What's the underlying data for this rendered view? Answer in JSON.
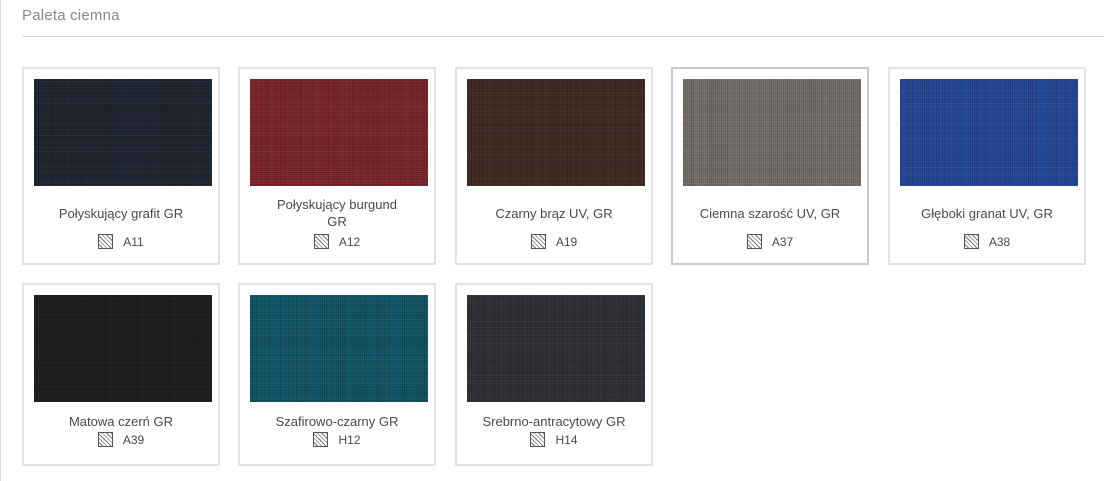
{
  "section": {
    "title": "Paleta ciemna"
  },
  "swatches": [
    {
      "name": "Połyskujący grafit GR",
      "code": "A11",
      "color": "#1d232e",
      "thread": "#3a4458",
      "selected": false
    },
    {
      "name": "Połyskujący burgund GR",
      "code": "A12",
      "color": "#7a2228",
      "thread": "#a94148",
      "selected": false
    },
    {
      "name": "Czarny brąz UV, GR",
      "code": "A19",
      "color": "#3e2a24",
      "thread": "#5b4036",
      "selected": false
    },
    {
      "name": "Ciemna szarość UV, GR",
      "code": "A37",
      "color": "#6f6c68",
      "thread": "#8d8a85",
      "selected": true
    },
    {
      "name": "Głęboki granat UV, GR",
      "code": "A38",
      "color": "#23469a",
      "thread": "#3a62b8",
      "selected": false
    },
    {
      "name": "Matowa czerń GR",
      "code": "A39",
      "color": "#1e1e1e",
      "thread": "#343434",
      "selected": false
    },
    {
      "name": "Szafirowo-czarny GR",
      "code": "H12",
      "color": "#0f5367",
      "thread": "#1f7a90",
      "selected": false
    },
    {
      "name": "Srebrno-antracytowy GR",
      "code": "H14",
      "color": "#2d2f32",
      "thread": "#4a4c50",
      "selected": false
    }
  ],
  "name_lines": {
    "1": [
      "Połyskujący burgund",
      "GR"
    ]
  }
}
